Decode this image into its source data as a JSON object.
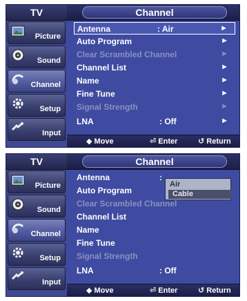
{
  "screens": [
    {
      "side_title": "TV",
      "sidebar": [
        {
          "label": "Picture",
          "icon": "picture-icon"
        },
        {
          "label": "Sound",
          "icon": "sound-icon"
        },
        {
          "label": "Channel",
          "icon": "channel-icon"
        },
        {
          "label": "Setup",
          "icon": "setup-icon"
        },
        {
          "label": "Input",
          "icon": "input-icon"
        }
      ],
      "header": "Channel",
      "menu": [
        {
          "label": "Antenna",
          "value": ": Air",
          "arrow": "►"
        },
        {
          "label": "Auto Program",
          "value": "",
          "arrow": "►"
        },
        {
          "label": "Clear Scrambled Channel",
          "value": "",
          "arrow": "►"
        },
        {
          "label": "Channel List",
          "value": "",
          "arrow": "►"
        },
        {
          "label": "Name",
          "value": "",
          "arrow": "►"
        },
        {
          "label": "Fine Tune",
          "value": "",
          "arrow": "►"
        },
        {
          "label": "Signal Strength",
          "value": "",
          "arrow": "►"
        },
        {
          "label": "LNA",
          "value": ": Off",
          "arrow": "►"
        }
      ],
      "footer": {
        "move": "◆ Move",
        "enter": "⏎ Enter",
        "return": "↺ Return"
      }
    },
    {
      "side_title": "TV",
      "sidebar": [
        {
          "label": "Picture",
          "icon": "picture-icon"
        },
        {
          "label": "Sound",
          "icon": "sound-icon"
        },
        {
          "label": "Channel",
          "icon": "channel-icon"
        },
        {
          "label": "Setup",
          "icon": "setup-icon"
        },
        {
          "label": "Input",
          "icon": "input-icon"
        }
      ],
      "header": "Channel",
      "menu": [
        {
          "label": "Antenna",
          "value": ":"
        },
        {
          "label": "Auto Program",
          "value": ""
        },
        {
          "label": "Clear Scrambled Channel",
          "value": ""
        },
        {
          "label": "Channel List",
          "value": ""
        },
        {
          "label": "Name",
          "value": ""
        },
        {
          "label": "Fine Tune",
          "value": ""
        },
        {
          "label": "Signal Strength",
          "value": ""
        },
        {
          "label": "LNA",
          "value": ": Off"
        }
      ],
      "popup": {
        "options": [
          "Air",
          "Cable"
        ],
        "highlighted": "Cable"
      },
      "footer": {
        "move": "◆ Move",
        "enter": "⏎ Enter",
        "return": "↺ Return"
      }
    }
  ],
  "colors": {
    "panel": "#3e4ba0",
    "highlight_border": "#ffffff",
    "disabled_text": "#8a90bf"
  }
}
